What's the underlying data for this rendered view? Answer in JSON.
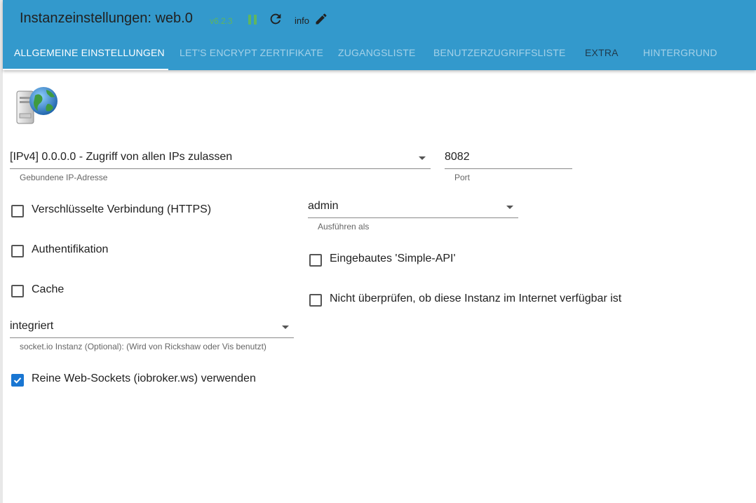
{
  "header": {
    "title": "Instanzeinstellungen: web.0",
    "version": "v6.2.3",
    "info_label": "info",
    "icons": [
      "pause-icon",
      "reload-icon",
      "edit-icon"
    ],
    "colors": {
      "bar": "#3399cc",
      "version": "#5fb65f",
      "checkbox": "#1976d2"
    }
  },
  "tabs": [
    {
      "label": "ALLGEMEINE EINSTELLUNGEN",
      "active": true
    },
    {
      "label": "LET'S ENCRYPT ZERTIFIKATE"
    },
    {
      "label": "ZUGANGSLISTE"
    },
    {
      "label": "BENUTZERZUGRIFFSLISTE"
    },
    {
      "label": "EXTRA"
    },
    {
      "label": "HINTERGRUND"
    }
  ],
  "form": {
    "ip": {
      "value": "[IPv4] 0.0.0.0 - Zugriff von allen IPs zulassen",
      "helper": "Gebundene IP-Adresse"
    },
    "port": {
      "value": "8082",
      "helper": "Port"
    },
    "https": {
      "label": "Verschlüsselte Verbindung (HTTPS)",
      "checked": false
    },
    "run_as": {
      "value": "admin",
      "helper": "Ausführen als"
    },
    "auth": {
      "label": "Authentifikation",
      "checked": false
    },
    "simple_api": {
      "label": "Eingebautes 'Simple-API'",
      "checked": false
    },
    "cache": {
      "label": "Cache",
      "checked": false
    },
    "no_check": {
      "label": "Nicht überprüfen, ob diese Instanz im Internet verfügbar ist",
      "checked": false
    },
    "socketio": {
      "value": "integriert",
      "helper": "socket.io Instanz (Optional): (Wird von Rickshaw oder Vis benutzt)"
    },
    "pure_ws": {
      "label": "Reine Web-Sockets (iobroker.ws) verwenden",
      "checked": true
    }
  }
}
